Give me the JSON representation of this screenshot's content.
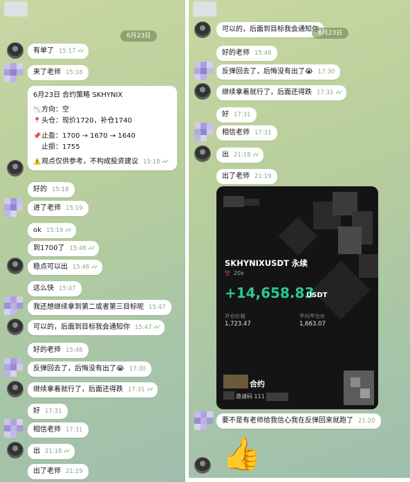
{
  "date_label": "6月23日",
  "left_messages": [
    {
      "text": "有单了",
      "time": "15:17",
      "read": true
    },
    {
      "text": "来了老师",
      "time": "15:18",
      "read": false
    },
    {
      "text": "好的",
      "time": "15:18",
      "read": false
    },
    {
      "text": "进了老师",
      "time": "15:19",
      "read": false
    },
    {
      "text": "ok",
      "time": "15:19",
      "read": true
    },
    {
      "text": "到1700了",
      "time": "15:46",
      "read": true
    },
    {
      "text": "稳点可以出",
      "time": "15:46",
      "read": true
    },
    {
      "text": "这么快",
      "time": "15:47",
      "read": false
    },
    {
      "text": "我还想继续拿到第二或者第三目标呢",
      "time": "15:47",
      "read": false
    },
    {
      "text": "可以的，后面到目标我会通知你",
      "time": "15:47",
      "read": true
    },
    {
      "text": "好的老师",
      "time": "15:48",
      "read": false
    },
    {
      "text": "反弹回去了，后悔没有出了😭",
      "time": "17:30",
      "read": false
    },
    {
      "text": "继续拿着就行了，后面还得跌",
      "time": "17:31",
      "read": true
    },
    {
      "text": "好",
      "time": "17:31",
      "read": false
    },
    {
      "text": "相信老师",
      "time": "17:31",
      "read": false
    },
    {
      "text": "出",
      "time": "21:18",
      "read": true
    },
    {
      "text": "出了老师",
      "time": "21:19",
      "read": false
    }
  ],
  "strategy": {
    "header": "6月23日 合约策略  SKHYNIX",
    "direction": "方向：空",
    "entry": "头仓：现价1720，补仓1740",
    "tp": "止盈：1700 → 1670 → 1640",
    "sl": "止损：1755",
    "note": "观点仅供参考，不构成投资建议",
    "time": "15:18"
  },
  "right_messages": [
    {
      "text": "可以的，后面到目标我会通知你",
      "time": "",
      "read": false
    },
    {
      "text": "好的老师",
      "time": "15:48",
      "read": false
    },
    {
      "text": "反弹回去了，后悔没有出了😭",
      "time": "17:30",
      "read": false
    },
    {
      "text": "继续拿着就行了，后面还得跌",
      "time": "17:31",
      "read": true
    },
    {
      "text": "好",
      "time": "17:31",
      "read": false
    },
    {
      "text": "相信老师",
      "time": "17:31",
      "read": false
    },
    {
      "text": "出",
      "time": "21:18",
      "read": true
    },
    {
      "text": "出了老师",
      "time": "21:19",
      "read": false
    },
    {
      "text": "要不是有老师给我信心我在反弹回来就跑了",
      "time": "21:20",
      "read": false
    }
  ],
  "pnl_card": {
    "pair": "SKHYNIXUSDT 永续",
    "side": "空",
    "leverage": "20x",
    "pnl": "+14,658.83",
    "unit": "USDT",
    "open_label": "开仓价格",
    "open_value": "1,723.47",
    "close_label": "平均平仓价",
    "close_value": "1,663.07",
    "brand": "合约",
    "invite_label": "邀请码 111"
  },
  "sticker": "👍",
  "colors": {
    "accent_green": "#4fae4e",
    "pnl_green": "#29c98f",
    "short_red": "#e8505b"
  }
}
